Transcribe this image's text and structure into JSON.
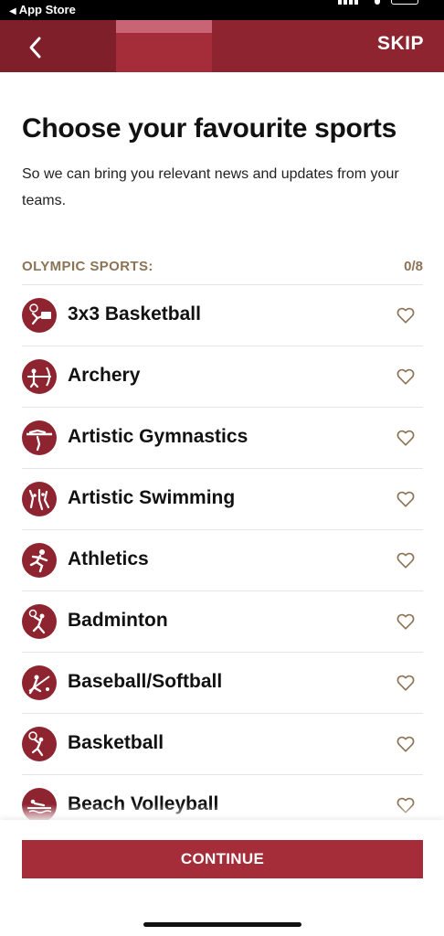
{
  "status_bar": {
    "back_label": "App Store"
  },
  "header": {
    "skip_label": "SKIP",
    "colors": {
      "primary": "#8e2430",
      "dark": "#7f1f29",
      "active": "#a52c39",
      "active_top": "#c86473"
    }
  },
  "title": "Choose your favourite sports",
  "subtitle": "So we can bring you relevant news and updates from your teams.",
  "section": {
    "label": "OLYMPIC SPORTS:",
    "count": "0/8"
  },
  "sports": [
    {
      "name": "3x3 Basketball",
      "icon": "basketball-3x3-icon"
    },
    {
      "name": "Archery",
      "icon": "archery-icon"
    },
    {
      "name": "Artistic Gymnastics",
      "icon": "gymnastics-icon"
    },
    {
      "name": "Artistic Swimming",
      "icon": "swimming-icon"
    },
    {
      "name": "Athletics",
      "icon": "athletics-icon"
    },
    {
      "name": "Badminton",
      "icon": "badminton-icon"
    },
    {
      "name": "Baseball/Softball",
      "icon": "baseball-icon"
    },
    {
      "name": "Basketball",
      "icon": "basketball-icon"
    },
    {
      "name": "Beach Volleyball",
      "icon": "beach-volleyball-icon"
    }
  ],
  "continue_label": "CONTINUE",
  "accent_gold": "#8c7355"
}
